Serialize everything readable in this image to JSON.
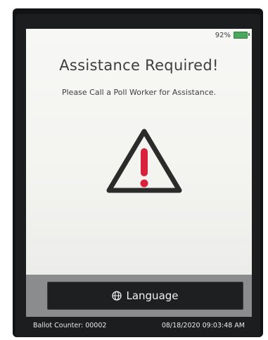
{
  "status": {
    "battery_text": "92%"
  },
  "alert": {
    "title": "Assistance Required!",
    "message": "Please Call a Poll Worker for Assistance.",
    "icon": "warning-triangle-icon"
  },
  "actions": {
    "language_label": "Language",
    "language_icon": "globe-icon"
  },
  "footer": {
    "ballot_counter": "Ballot Counter: 00002",
    "datetime": "08/18/2020 09:03:48 AM"
  },
  "colors": {
    "warning_red": "#d8223b",
    "battery_green": "#4aa85c",
    "button_bg": "#1d1f21"
  }
}
